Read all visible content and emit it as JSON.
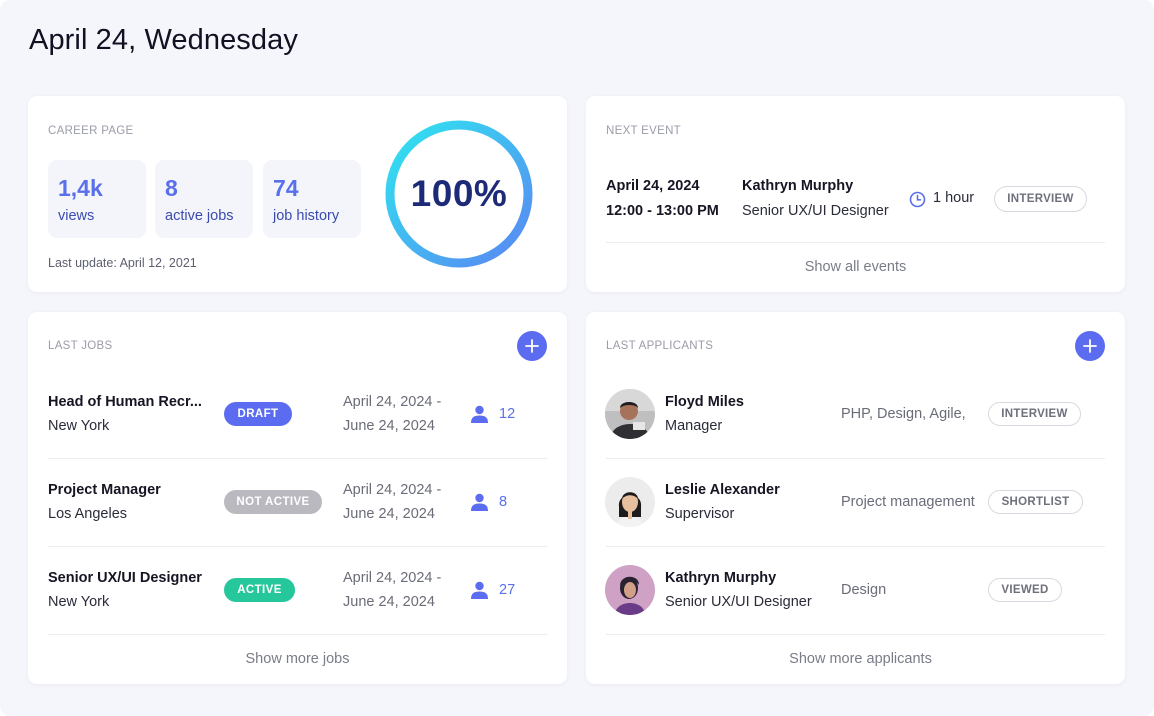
{
  "header": {
    "title": "April 24, Wednesday"
  },
  "career": {
    "label": "CAREER PAGE",
    "stats": [
      {
        "value": "1,4k",
        "label": "views"
      },
      {
        "value": "8",
        "label": "active jobs"
      },
      {
        "value": "74",
        "label": "job history"
      }
    ],
    "last_update": "Last update: April 12, 2021",
    "progress_text": "100%",
    "progress_fraction": 1.0
  },
  "next_event": {
    "label": "NEXT EVENT",
    "date": "April 24, 2024",
    "time": "12:00 - 13:00 PM",
    "person": "Kathryn Murphy",
    "role": "Senior UX/UI Designer",
    "duration": "1 hour",
    "type_badge": "INTERVIEW",
    "show_all": "Show all events"
  },
  "last_jobs": {
    "label": "LAST JOBS",
    "show_more": "Show more jobs",
    "rows": [
      {
        "title": "Head of Human Recr...",
        "location": "New York",
        "status": "DRAFT",
        "status_color": "#5b6cf0",
        "date_start": "April 24, 2024 -",
        "date_end": "June 24, 2024",
        "count": "12"
      },
      {
        "title": "Project Manager",
        "location": "Los Angeles",
        "status": "NOT ACTIVE",
        "status_color": "#b9b9bf",
        "date_start": "April 24, 2024 -",
        "date_end": "June 24, 2024",
        "count": "8"
      },
      {
        "title": "Senior UX/UI Designer",
        "location": "New York",
        "status": "ACTIVE",
        "status_color": "#25c79b",
        "date_start": "April 24, 2024 -",
        "date_end": "June 24, 2024",
        "count": "27"
      }
    ]
  },
  "last_applicants": {
    "label": "LAST APPLICANTS",
    "show_more": "Show more applicants",
    "rows": [
      {
        "name": "Floyd Miles",
        "role": "Manager",
        "tags": "PHP, Design, Agile,",
        "status": "INTERVIEW"
      },
      {
        "name": "Leslie Alexander",
        "role": "Supervisor",
        "tags": "Project management",
        "status": "SHORTLIST"
      },
      {
        "name": "Kathryn Murphy",
        "role": "Senior UX/UI Designer",
        "tags": "Design",
        "status": "VIEWED"
      }
    ]
  },
  "colors": {
    "accent": "#5b6cf0",
    "stat_value": "#5a70ea",
    "ring_start": "#2ee6f0",
    "ring_end": "#5a86f2"
  },
  "icons": [
    "plus-icon",
    "clock-icon",
    "person-icon"
  ]
}
